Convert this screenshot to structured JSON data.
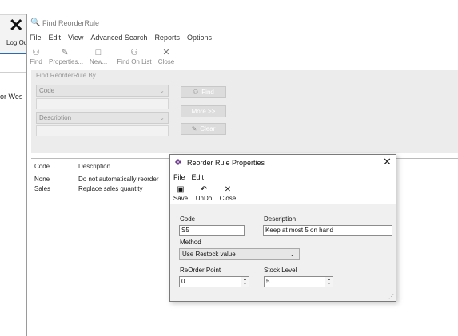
{
  "background": {
    "logout_label": "Log Out",
    "side_text": "or Wes"
  },
  "find_window": {
    "title": "Find ReorderRule",
    "menu": [
      "File",
      "Edit",
      "View",
      "Advanced Search",
      "Reports",
      "Options"
    ],
    "toolbar": {
      "find": "Find",
      "properties": "Properties...",
      "new": "New...",
      "find_on_list": "Find On List",
      "close": "Close"
    },
    "find_by_label": "Find ReorderRule By",
    "criteria": {
      "first_field": "Code",
      "second_field": "Description"
    },
    "buttons": {
      "find": "Find",
      "more": "More >>",
      "clear": "Clear"
    },
    "list": {
      "headers": [
        "Code",
        "Description"
      ],
      "rows": [
        {
          "code": "None",
          "description": "Do not automatically reorder"
        },
        {
          "code": "Sales",
          "description": "Replace sales quantity"
        }
      ]
    }
  },
  "dialog": {
    "title": "Reorder Rule Properties",
    "menu": [
      "File",
      "Edit"
    ],
    "toolbar": {
      "save": "Save",
      "undo": "UnDo",
      "close": "Close"
    },
    "code_label": "Code",
    "code_value": "S5",
    "description_label": "Description",
    "description_value": "Keep at most 5 on hand",
    "method_label": "Method",
    "method_value": "Use Restock value",
    "reorder_point_label": "ReOrder Point",
    "reorder_point_value": "0",
    "stock_level_label": "Stock Level",
    "stock_level_value": "5"
  }
}
